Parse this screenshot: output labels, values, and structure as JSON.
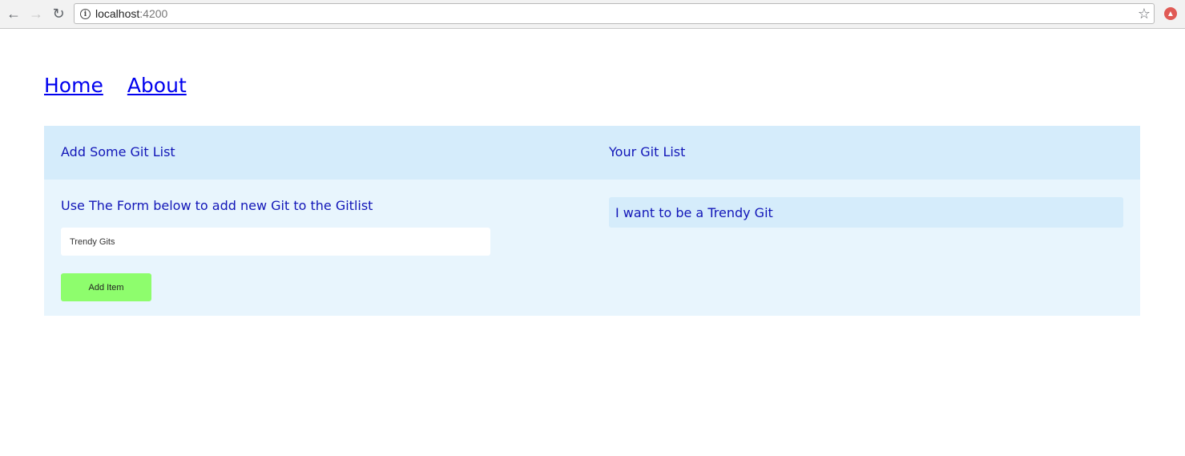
{
  "browser": {
    "url_host": "localhost",
    "url_port": ":4200"
  },
  "nav": {
    "links": [
      "Home",
      "About"
    ]
  },
  "form_panel": {
    "title": "Add Some Git List",
    "caption": "Use The Form below to add new Git to the Gitlist",
    "input_value": "Trendy Gits",
    "button_label": "Add Item"
  },
  "list_panel": {
    "title": "Your Git List",
    "items": [
      "I want to be a Trendy Git"
    ]
  },
  "colors": {
    "header_bg": "#d5ecfb",
    "panel_bg": "#e8f5fd",
    "text": "#1216b8",
    "button_bg": "#8efd6d"
  }
}
